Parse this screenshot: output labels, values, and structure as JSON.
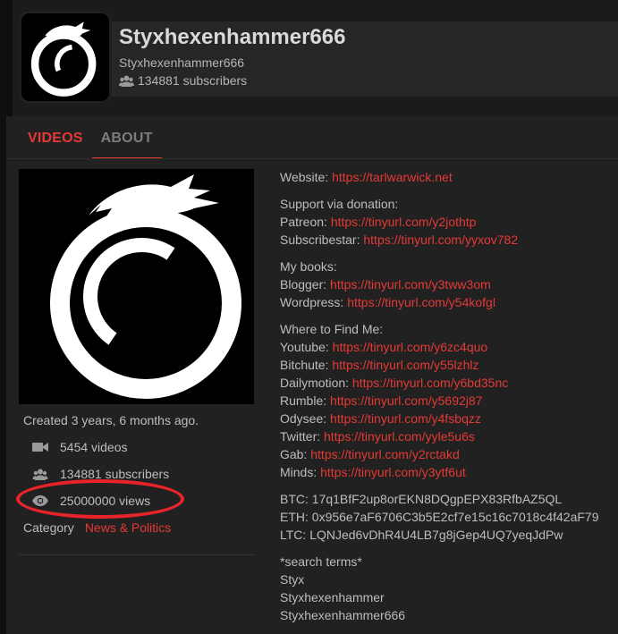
{
  "channel": {
    "title": "Styxhexenhammer666",
    "handle": "Styxhexenhammer666",
    "subscribers_header": "134881 subscribers"
  },
  "tabs": [
    {
      "label": "VIDEOS",
      "active": true
    },
    {
      "label": "ABOUT",
      "active": false
    }
  ],
  "left": {
    "created": "Created 3 years, 6 months ago.",
    "videos": "5454 videos",
    "subscribers": "134881 subscribers",
    "views": "25000000 views",
    "category_label": "Category",
    "category_value": "News & Politics"
  },
  "about": {
    "website_label": "Website:",
    "website_url": "https://tarlwarwick.net",
    "support_title": "Support via donation:",
    "patreon_label": "Patreon:",
    "patreon_url": "https://tinyurl.com/y2jothtp",
    "subscribestar_label": "Subscribestar:",
    "subscribestar_url": "https://tinyurl.com/yyxov782",
    "books_title": "My books:",
    "blogger_label": "Blogger:",
    "blogger_url": "https://tinyurl.com/y3tww3om",
    "wordpress_label": "Wordpress:",
    "wordpress_url": "https://tinyurl.com/y54kofgl",
    "find_title": "Where to Find Me:",
    "youtube_label": "Youtube:",
    "youtube_url": "https://tinyurl.com/y6zc4quo",
    "bitchute_label": "Bitchute:",
    "bitchute_url": "https://tinyurl.com/y55lzhlz",
    "dailymotion_label": "Dailymotion:",
    "dailymotion_url": "https://tinyurl.com/y6bd35nc",
    "rumble_label": "Rumble:",
    "rumble_url": "https://tinyurl.com/y5692j87",
    "odysee_label": "Odysee:",
    "odysee_url": "https://tinyurl.com/y4fsbqzz",
    "twitter_label": "Twitter:",
    "twitter_url": "https://tinyurl.com/yyle5u6s",
    "gab_label": "Gab:",
    "gab_url": "https://tinyurl.com/y2rctakd",
    "minds_label": "Minds:",
    "minds_url": "https://tinyurl.com/y3ytf6ut",
    "btc": "BTC: 17q1BfF2up8orEKN8DQgpEPX83RfbAZ5QL",
    "eth": "ETH: 0x956e7aF6706C3b5E2cf7e15c16c7018c4f42aF79",
    "ltc": "LTC: LQNJed6vDhR4U4LB7g8jGep4UQ7yeqJdPw",
    "search_terms": "*search terms*",
    "term1": "Styx",
    "term2": "Styxhexenhammer",
    "term3": "Styxhexenhammer666"
  },
  "colors": {
    "accent": "#e53935",
    "annotation": "#e8242a",
    "background": "#212121"
  },
  "icons": [
    "video-camera-icon",
    "users-icon",
    "eye-icon"
  ]
}
